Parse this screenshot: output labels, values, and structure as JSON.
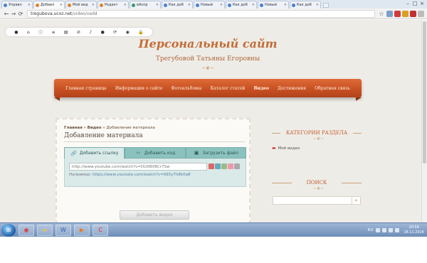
{
  "browser": {
    "tabs": [
      {
        "label": "Управл",
        "active": false
      },
      {
        "label": "Добавл",
        "active": true
      },
      {
        "label": "Моё вид",
        "active": false
      },
      {
        "label": "Редакт",
        "active": false
      },
      {
        "label": "вАспр",
        "active": false
      },
      {
        "label": "Как доб",
        "active": false
      },
      {
        "label": "Новый",
        "active": false
      },
      {
        "label": "Как доб",
        "active": false
      },
      {
        "label": "Новый",
        "active": false
      },
      {
        "label": "Как доб",
        "active": false
      }
    ],
    "url_host": "tregubova.ucoz.net",
    "url_path": "/video/vadd",
    "window_controls": [
      "–",
      "□",
      "×"
    ]
  },
  "site": {
    "title": "Персональный сайт",
    "subtitle": "Трегубовой Татьяны Егоровны",
    "nav": [
      {
        "label": "Главная страница",
        "current": false
      },
      {
        "label": "Информация о сайте",
        "current": false
      },
      {
        "label": "Фотоальбомы",
        "current": false
      },
      {
        "label": "Каталог статей",
        "current": false
      },
      {
        "label": "Видео",
        "current": true
      },
      {
        "label": "Достижения",
        "current": false
      },
      {
        "label": "Обратная связь",
        "current": false
      }
    ]
  },
  "content": {
    "breadcrumb": {
      "home": "Главная",
      "sep1": " » ",
      "section": "Видео",
      "sep2": " » ",
      "current": "Добавление материала"
    },
    "title": "Добавление материала",
    "tabs": [
      {
        "label": "Добавить ссылку",
        "icon": "link-icon",
        "active": true
      },
      {
        "label": "Добавить код",
        "icon": "code-icon",
        "active": false
      },
      {
        "label": "Загрузить файл",
        "icon": "upload-icon",
        "active": false
      }
    ],
    "url_placeholder": "http://www.youtube.com/watch?v=DUXBVBCr7Sw",
    "example_prefix": "Например: ",
    "example_link": "https://www.youtube.com/watch?v=K65yTh8k0a8",
    "add_button": "Добавить видео"
  },
  "sidebar": {
    "categories_title": "КАТЕГОРИИ РАЗДЕЛА",
    "category_link": "Моё видео",
    "search_title": "ПОИСК"
  },
  "taskbar": {
    "lang": "RU",
    "time": "20:58",
    "date": "28.11.2016"
  },
  "colors": {
    "accent": "#c64f22",
    "title": "#c36d37",
    "tabs": "#8cc2be"
  }
}
